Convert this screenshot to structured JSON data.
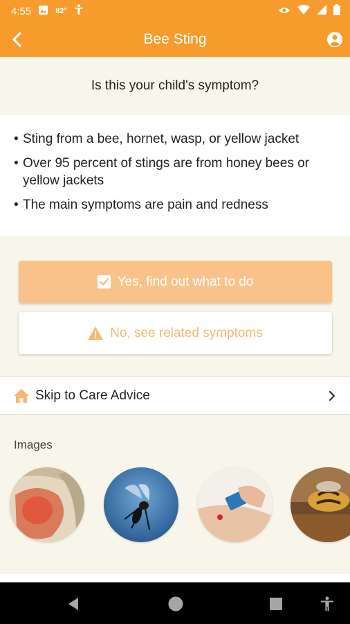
{
  "status_bar": {
    "time": "4:55",
    "temperature": "82°",
    "icons": [
      "image-icon",
      "accessibility-icon",
      "eye-icon",
      "wifi-icon",
      "signal-icon",
      "battery-icon"
    ]
  },
  "app_bar": {
    "title": "Bee Sting",
    "back_icon": "chevron-left-icon",
    "account_icon": "account-circle-icon"
  },
  "question": "Is this your child's symptom?",
  "bullets": [
    "Sting from a bee, hornet, wasp, or yellow jacket",
    "Over 95 percent of stings are from honey bees or yellow jackets",
    "The main symptoms are pain and redness"
  ],
  "buttons": {
    "yes_label": "Yes, find out what to do",
    "no_label": "No, see related symptoms"
  },
  "skip": {
    "label": "Skip to Care Advice",
    "icon": "home-icon"
  },
  "images": {
    "label": "Images",
    "thumbnails": [
      "red-swollen-arm",
      "wasp",
      "scraping-stinger",
      "honey-bee"
    ]
  },
  "colors": {
    "primary": "#f79b2c",
    "yes_button": "#f9c28a",
    "no_button_text": "#f9b872",
    "background": "#f8f6ea"
  }
}
